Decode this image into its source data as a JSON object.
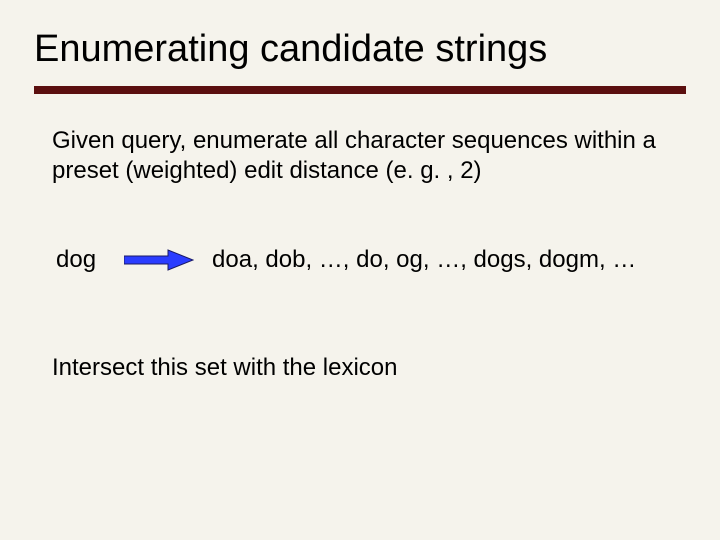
{
  "slide": {
    "title": "Enumerating candidate strings",
    "paragraph1": "Given query, enumerate all character sequences within a preset (weighted) edit distance (e. g. , 2)",
    "example": {
      "query": "dog",
      "candidates": "doa, dob, …, do, og, …, dogs, dogm, …"
    },
    "paragraph2": "Intersect this set with the lexicon",
    "arrow_fill": "#2a3cff",
    "arrow_stroke": "#1a1a66",
    "rule_color": "#5b0f0f"
  }
}
